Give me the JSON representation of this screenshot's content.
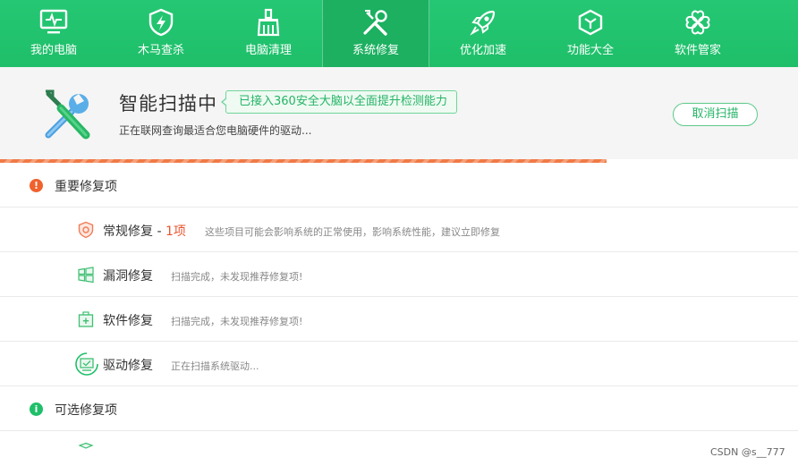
{
  "nav": {
    "items": [
      {
        "label": "我的电脑",
        "icon": "monitor-icon"
      },
      {
        "label": "木马查杀",
        "icon": "shield-lightning-icon"
      },
      {
        "label": "电脑清理",
        "icon": "broom-icon"
      },
      {
        "label": "系统修复",
        "icon": "tools-icon"
      },
      {
        "label": "优化加速",
        "icon": "rocket-icon"
      },
      {
        "label": "功能大全",
        "icon": "cube-icon"
      },
      {
        "label": "软件管家",
        "icon": "apps-icon"
      }
    ],
    "active": "系统修复"
  },
  "scan": {
    "title": "智能扫描中",
    "badge": "已接入360安全大脑以全面提升检测能力",
    "subtitle": "正在联网查询最适合您电脑硬件的驱动...",
    "cancel_label": "取消扫描",
    "progress": 0.76
  },
  "sections": {
    "important": {
      "title": "重要修复项",
      "icon_glyph": "!"
    },
    "optional": {
      "title": "可选修复项",
      "icon_glyph": "i"
    }
  },
  "rows": {
    "routine": {
      "title": "常规修复",
      "sep": " - ",
      "count": "1项",
      "desc": "这些项目可能会影响系统的正常使用，影响系统性能，建议立即修复"
    },
    "vuln": {
      "title": "漏洞修复",
      "desc": "扫描完成，未发现推荐修复项!"
    },
    "software": {
      "title": "软件修复",
      "desc": "扫描完成，未发现推荐修复项!"
    },
    "driver": {
      "title": "驱动修复",
      "desc": "正在扫描系统驱动..."
    }
  },
  "footer": {
    "watermark": "CSDN @s__777"
  },
  "colors": {
    "brand_green": "#1fbf69",
    "accent_orange": "#e9542f",
    "info_green": "#1fbf69"
  }
}
